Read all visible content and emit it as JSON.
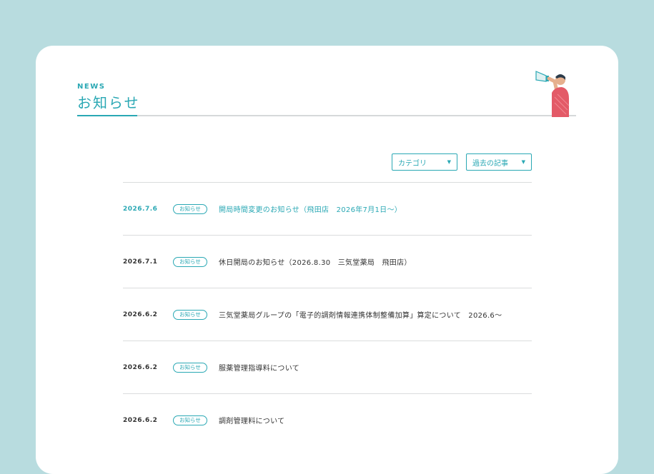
{
  "section": {
    "eyebrow": "NEWS",
    "title": "お知らせ"
  },
  "filters": {
    "category_label": "カテゴリ",
    "past_label": "過去の記事"
  },
  "news": [
    {
      "date": "2026.7.6",
      "badge": "お知らせ",
      "text": "開局時間変更のお知らせ（飛田店　2026年7月1日〜）"
    },
    {
      "date": "2026.7.1",
      "badge": "お知らせ",
      "text": "休日開局のお知らせ（2026.8.30　三気堂薬局　飛田店）"
    },
    {
      "date": "2026.6.2",
      "badge": "お知らせ",
      "text": "三気堂薬局グループの「電子的調剤情報連携体制整備加算」算定について　2026.6〜"
    },
    {
      "date": "2026.6.2",
      "badge": "お知らせ",
      "text": "服薬管理指導料について"
    },
    {
      "date": "2026.6.2",
      "badge": "お知らせ",
      "text": "調剤管理料について"
    }
  ],
  "colors": {
    "background": "#b8dcdf",
    "accent": "#2aa8b4",
    "card": "#ffffff"
  },
  "icons": {
    "mascot": "megaphone-person-icon",
    "dropdown": "triangle-down-icon"
  }
}
